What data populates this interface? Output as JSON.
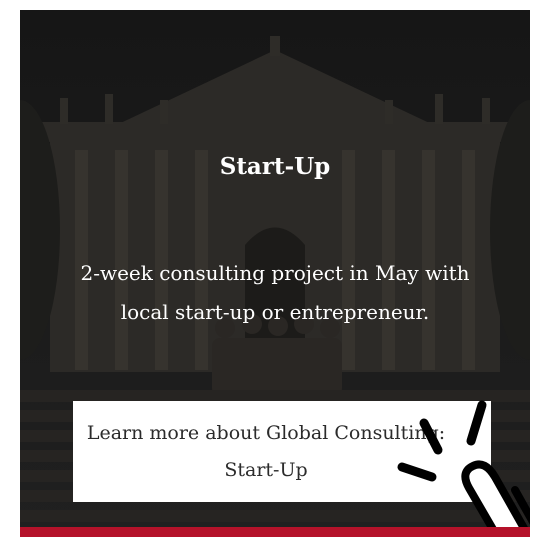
{
  "card": {
    "title": "Start-Up",
    "description": "2-week consulting project in May with local start-up or entrepreneur.",
    "cta_label": "Learn more about Global Consulting: Start-Up"
  },
  "colors": {
    "overlay": "#1b1b1b",
    "text": "#ffffff",
    "cta_background": "#ffffff",
    "cta_text": "#2b2b2b",
    "accent_bar": "#b5122a"
  },
  "icons": {
    "pointer": "hand-click-icon"
  }
}
